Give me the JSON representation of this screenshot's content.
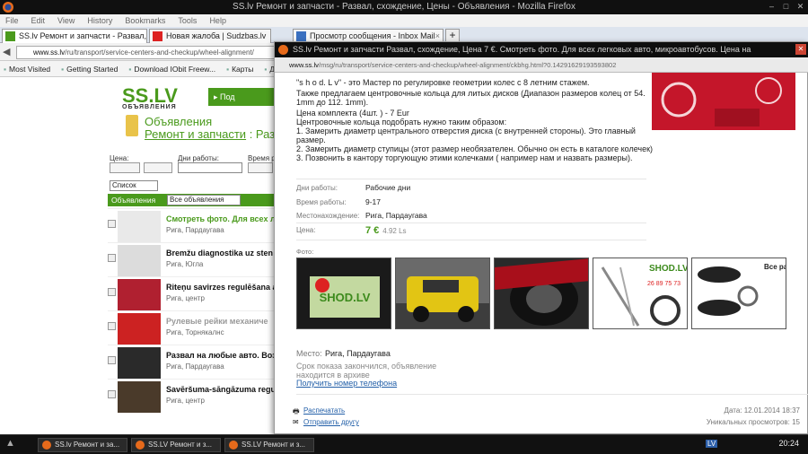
{
  "window": {
    "title": "SS.lv Ремонт и запчасти - Развал, схождение, Цены - Объявления - Mozilla Firefox"
  },
  "menu": [
    "File",
    "Edit",
    "View",
    "History",
    "Bookmarks",
    "Tools",
    "Help"
  ],
  "tabs": [
    {
      "label": "SS.lv Ремонт и запчасти - Развал, схож..."
    },
    {
      "label": "Новая жалоба | Sudzbas.lv"
    },
    {
      "label": "Просмотр сообщения - Inbox Mail"
    }
  ],
  "address": {
    "host": "www.ss.lv",
    "path": "/ru/transport/service-centers-and-checkup/wheel-alignment/"
  },
  "bookmarks": [
    "Most Visited",
    "Getting Started",
    "Download IObit Freew...",
    "Карты",
    "Диск"
  ],
  "site": {
    "logo": "SS.LV",
    "logo_sub": "ОБЪЯВЛЕНИЯ",
    "nav_btn": "▸ Под",
    "section": "Объявления",
    "category_link": "Ремонт и запчасти",
    "category_rest": " : Раз",
    "filters": {
      "price": "Цена:",
      "days": "Дни работы:",
      "time": "Время р"
    },
    "view_select": "Список",
    "list_header": "Объявления",
    "list_select": "Все объявления",
    "rows": [
      {
        "title": "Смотреть фото. Для всех ли",
        "sub": "Рига, Пардаугава",
        "color": "#4a9a1c"
      },
      {
        "title": "Bremžu diagnostika uz sten",
        "sub": "Рига, Югла",
        "color": "#111"
      },
      {
        "title": "Riteņu savirzes regulēšana a",
        "sub": "Рига, центр",
        "color": "#111"
      },
      {
        "title": "Рулевые рейки механиче",
        "sub": "Рига, Торнякалнс",
        "color": "#999"
      },
      {
        "title": "Развал на любые авто. Возм",
        "sub": "Рига, Пардаугава",
        "color": "#111"
      },
      {
        "title": "Savēršuma-sāngāzuma regu",
        "sub": "Рига, центр",
        "color": "#111"
      }
    ]
  },
  "popup": {
    "title": "SS.lv Ремонт и запчасти Развал, схождение, Цена 7 €. Смотреть фото. Для всех легковых авто, микроавтобусов. Цена на",
    "url_host": "www.ss.lv",
    "url_path": "/msg/ru/transport/service-centers-and-checkup/wheel-alignment/ckbhg.html?0.14291629193593802",
    "desc": [
      "\"s h o d. L v\" - это Мастер по регулировке геометрии колес с 8 летним стажем.",
      "Также предлагаем центровочные кольца для литых дисков (Диапазон размеров колец от 54. 1mm до 112. 1mm).",
      "Цена комплекта (4шт. ) - 7 Eur",
      "Центровочные кольца подобрать нужно таким образом:",
      "1. Замерить диаметр центрального отверстия диска (с внутренней стороны). Это главный размер.",
      "2. Замерить диаметр ступицы (этот размер необязателен. Обычно он есть в каталоге колечек)",
      "3. Позвонить в кантору торгующую этими колечками ( например нам и назвать размеры)."
    ],
    "details": [
      {
        "k": "Дни работы:",
        "v": "Рабочие дни"
      },
      {
        "k": "Время работы:",
        "v": "9-17"
      },
      {
        "k": "Местонахождение:",
        "v": "Рига, Пардаугава"
      }
    ],
    "price_label": "Цена:",
    "price": "7 €",
    "price_ls": "4.92 Ls",
    "photo_label": "Фото:",
    "photo1_text": "SHOD.LV",
    "photo4_text": "SHOD.LV",
    "photo4_phone": "26 89 75 73",
    "photo5_text": "Все раз",
    "place_label": "Место:",
    "place": "Рига, Пардаугава",
    "expired": "Срок показа закончился, объявление находится в архиве",
    "phone_link": "Получить номер телефона",
    "print": "Распечатать",
    "send": "Отправить другу",
    "date": "Дата: 12.01.2014 18:37",
    "views": "Уникальных просмотров: 15"
  },
  "taskbar": {
    "items": [
      "SS.lv Ремонт и за...",
      "SS.LV Ремонт и з...",
      "SS.LV Ремонт и з..."
    ],
    "lang": "LV",
    "time": "20:24"
  },
  "colors": {
    "brand_green": "#4a9a1c",
    "link": "#225fa8",
    "ad_red": "#c4162a"
  }
}
